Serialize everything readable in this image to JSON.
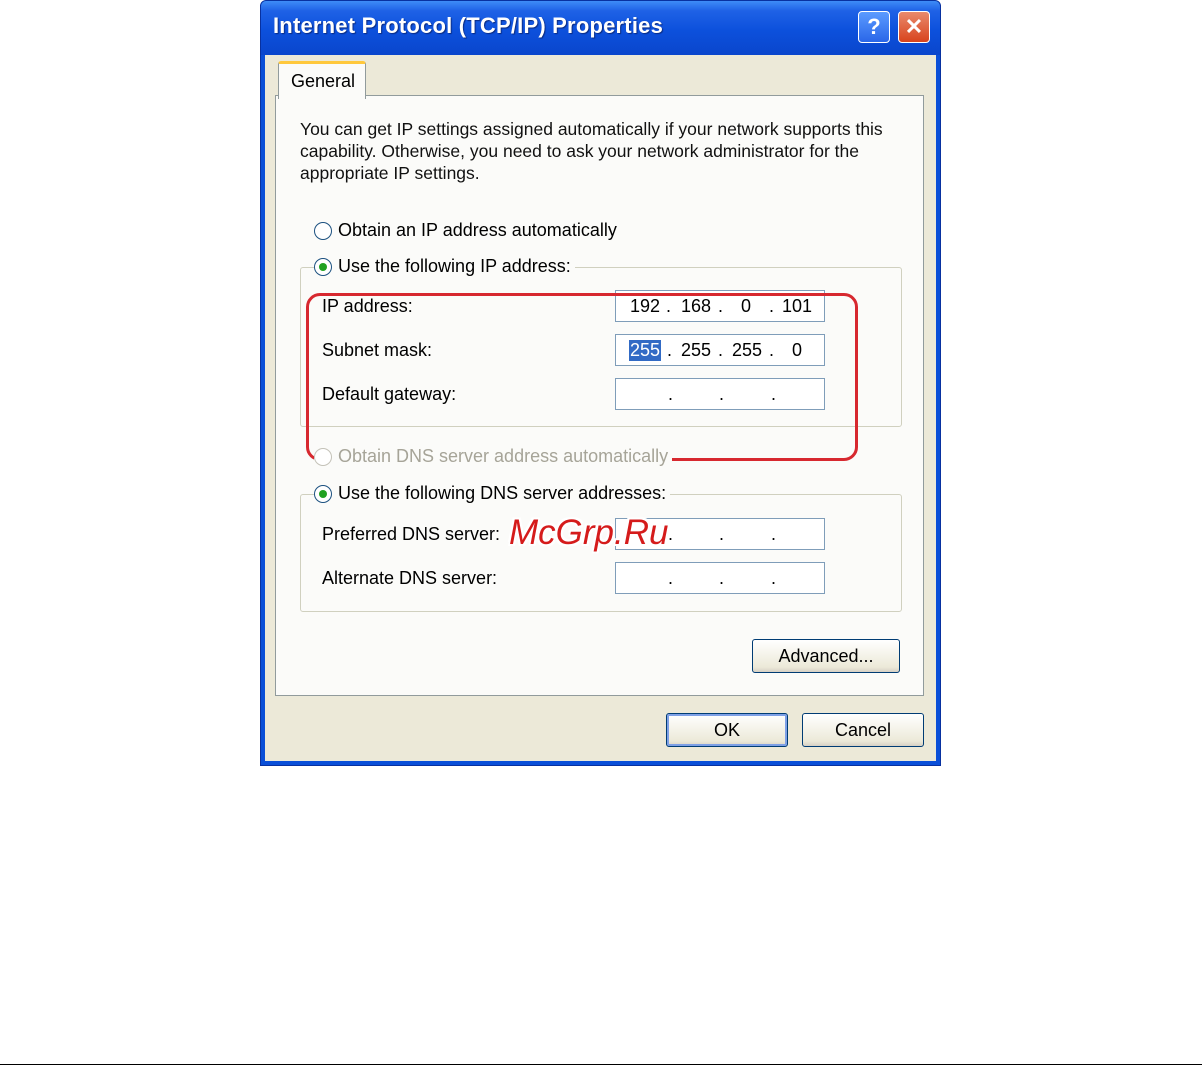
{
  "window": {
    "title": "Internet Protocol (TCP/IP) Properties",
    "help_glyph": "?",
    "close_glyph": "✕"
  },
  "tabs": [
    {
      "label": "General"
    }
  ],
  "description": "You can get IP settings assigned automatically if your network supports this capability. Otherwise, you need to ask your network administrator for the appropriate IP settings.",
  "ip": {
    "auto_label": "Obtain an IP address automatically",
    "manual_label": "Use the following IP address:",
    "selected": "manual",
    "fields": [
      {
        "label": "IP address:",
        "octets": [
          "192",
          "168",
          "0",
          "101"
        ]
      },
      {
        "label": "Subnet mask:",
        "octets": [
          "255",
          "255",
          "255",
          "0"
        ],
        "selected_octet": 0
      },
      {
        "label": "Default gateway:",
        "octets": [
          "",
          "",
          "",
          ""
        ]
      }
    ]
  },
  "dns": {
    "auto_label": "Obtain DNS server address automatically",
    "manual_label": "Use the following DNS server addresses:",
    "selected": "manual",
    "auto_disabled": true,
    "fields": [
      {
        "label": "Preferred DNS server:",
        "octets": [
          "",
          "",
          "",
          ""
        ]
      },
      {
        "label": "Alternate DNS server:",
        "octets": [
          "",
          "",
          "",
          ""
        ]
      }
    ]
  },
  "buttons": {
    "advanced": "Advanced...",
    "ok": "OK",
    "cancel": "Cancel"
  },
  "watermark": "McGrp.Ru",
  "colors": {
    "title_bar": "#0c50dc",
    "highlight_outline": "#d7282f",
    "radio_dot": "#21a121",
    "selection": "#316ac5"
  }
}
